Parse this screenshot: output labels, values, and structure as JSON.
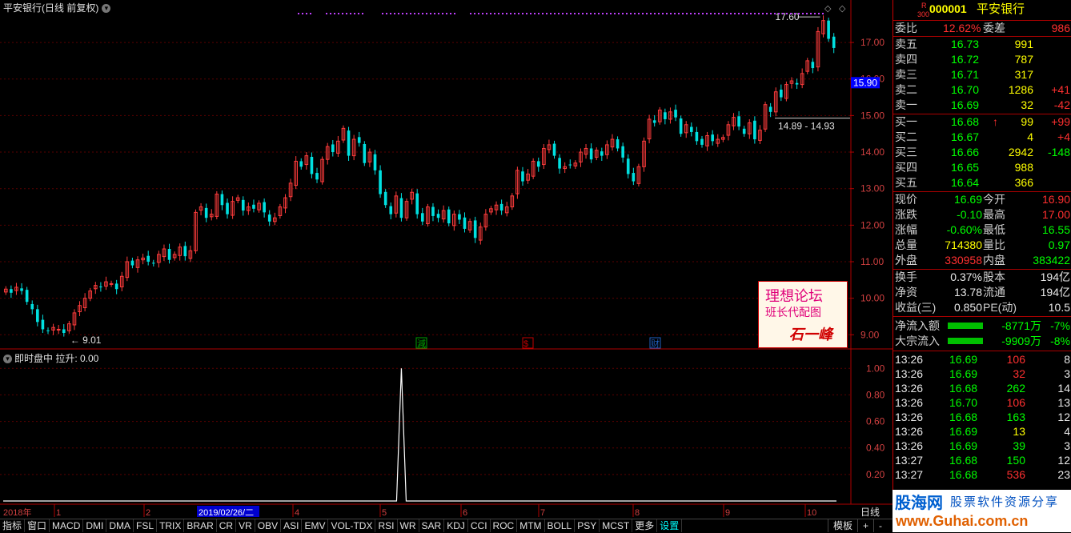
{
  "main_title": "平安银行(日线 前复权)",
  "sub_title": "即时盘中 拉升: 0.00",
  "chart_data": [
    {
      "type": "candlestick",
      "ylim": [
        8.7,
        17.9
      ],
      "y_ticks": [
        "17.00",
        "16.00",
        "15.00",
        "14.00",
        "13.00",
        "12.00",
        "11.00",
        "10.00",
        "9.00"
      ],
      "current_price_label": "15.90",
      "annotations": [
        "17.60",
        "14.89 - 14.93",
        "9.01"
      ],
      "event_markers": [
        "減",
        "$",
        "财"
      ],
      "x_labels": [
        "2018年",
        "1",
        "2",
        "2019/02/26/二",
        "4",
        "5",
        "6",
        "7",
        "8",
        "9",
        "10"
      ],
      "period_label": "日线",
      "closes": [
        10.25,
        10.15,
        10.3,
        10.2,
        9.9,
        9.7,
        9.35,
        9.15,
        9.1,
        9.2,
        9.15,
        9.05,
        9.3,
        9.6,
        9.8,
        10.0,
        10.2,
        10.35,
        10.3,
        10.45,
        10.4,
        10.25,
        10.6,
        11.0,
        10.9,
        11.05,
        11.1,
        11.0,
        10.95,
        11.2,
        11.35,
        11.05,
        11.2,
        11.4,
        11.15,
        11.3,
        12.35,
        12.5,
        12.2,
        12.3,
        12.85,
        12.55,
        12.3,
        12.65,
        12.75,
        12.4,
        12.5,
        12.45,
        12.6,
        12.35,
        12.1,
        12.2,
        12.5,
        12.75,
        13.15,
        13.75,
        13.6,
        13.9,
        13.4,
        13.25,
        13.8,
        14.15,
        14.0,
        14.3,
        14.65,
        13.9,
        14.35,
        14.25,
        13.7,
        14.0,
        13.5,
        12.85,
        12.55,
        12.3,
        12.8,
        12.2,
        12.65,
        12.9,
        12.3,
        12.1,
        12.5,
        12.25,
        12.2,
        12.4,
        12.05,
        12.3,
        12.15,
        11.9,
        12.1,
        11.65,
        11.95,
        12.3,
        12.45,
        12.55,
        12.4,
        12.5,
        12.8,
        13.5,
        13.2,
        13.4,
        13.75,
        13.6,
        14.1,
        14.2,
        13.9,
        13.55,
        13.6,
        13.65,
        13.7,
        14.0,
        14.1,
        13.8,
        14.05,
        13.9,
        14.2,
        14.35,
        14.1,
        13.85,
        13.4,
        13.2,
        13.6,
        14.3,
        14.9,
        14.8,
        15.15,
        14.9,
        15.1,
        14.95,
        14.5,
        14.75,
        14.55,
        14.3,
        14.2,
        14.45,
        14.3,
        14.35,
        14.4,
        14.75,
        14.95,
        14.7,
        14.5,
        14.8,
        14.35,
        14.6,
        15.3,
        15.1,
        15.65,
        15.5,
        15.85,
        15.95,
        15.85,
        16.15,
        16.5,
        16.3,
        17.3,
        17.6,
        17.1,
        16.85
      ],
      "panel2_series": {
        "name": "即时盘中 拉升",
        "y_ticks": [
          "1.00",
          "0.80",
          "0.60",
          "0.40",
          "0.20"
        ],
        "spike_index": 75,
        "spike_value": 1.0,
        "ylim": [
          0,
          1.05
        ]
      }
    }
  ],
  "quote": {
    "code_prefix": "R",
    "code_sub": "300",
    "code": "000001",
    "name": "平安银行",
    "weibi_label": "委比",
    "weibi_value": "12.62%",
    "weicha_label": "委差",
    "weicha_value": "986",
    "asks": [
      {
        "label": "卖五",
        "price": "16.73",
        "vol": "991",
        "chg": ""
      },
      {
        "label": "卖四",
        "price": "16.72",
        "vol": "787",
        "chg": ""
      },
      {
        "label": "卖三",
        "price": "16.71",
        "vol": "317",
        "chg": ""
      },
      {
        "label": "卖二",
        "price": "16.70",
        "vol": "1286",
        "chg": "+41"
      },
      {
        "label": "卖一",
        "price": "16.69",
        "vol": "32",
        "chg": "-42"
      }
    ],
    "bids": [
      {
        "label": "买一",
        "price": "16.68",
        "vol": "99",
        "chg": "+99",
        "arrow": "↑"
      },
      {
        "label": "买二",
        "price": "16.67",
        "vol": "4",
        "chg": "+4",
        "arrow": ""
      },
      {
        "label": "买三",
        "price": "16.66",
        "vol": "2942",
        "chg": "-148",
        "arrow": ""
      },
      {
        "label": "买四",
        "price": "16.65",
        "vol": "988",
        "chg": "",
        "arrow": ""
      },
      {
        "label": "买五",
        "price": "16.64",
        "vol": "366",
        "chg": "",
        "arrow": ""
      }
    ],
    "stats": [
      {
        "l1": "现价",
        "v1": "16.69",
        "c1": "g",
        "l2": "今开",
        "v2": "16.90",
        "c2": "r"
      },
      {
        "l1": "涨跌",
        "v1": "-0.10",
        "c1": "g",
        "l2": "最高",
        "v2": "17.00",
        "c2": "r"
      },
      {
        "l1": "涨幅",
        "v1": "-0.60%",
        "c1": "g",
        "l2": "最低",
        "v2": "16.55",
        "c2": "g"
      },
      {
        "l1": "总量",
        "v1": "714380",
        "c1": "y",
        "l2": "量比",
        "v2": "0.97",
        "c2": "g"
      },
      {
        "l1": "外盘",
        "v1": "330958",
        "c1": "r",
        "l2": "内盘",
        "v2": "383422",
        "c2": "g"
      }
    ],
    "stats2": [
      {
        "l1": "换手",
        "v1": "0.37%",
        "l2": "股本",
        "v2": "194亿"
      },
      {
        "l1": "净资",
        "v1": "13.78",
        "l2": "流通",
        "v2": "194亿"
      },
      {
        "l1": "收益(三)",
        "v1": "0.850",
        "l2": "PE(动)",
        "v2": "10.5"
      }
    ],
    "flow": [
      {
        "label": "净流入额",
        "value": "-8771万",
        "pct": "-7%"
      },
      {
        "label": "大宗流入",
        "value": "-9909万",
        "pct": "-8%"
      }
    ],
    "ticks": [
      {
        "t": "13:26",
        "p": "16.69",
        "v": "106",
        "vc": "r",
        "n": "8"
      },
      {
        "t": "13:26",
        "p": "16.69",
        "v": "32",
        "vc": "r",
        "n": "3"
      },
      {
        "t": "13:26",
        "p": "16.68",
        "v": "262",
        "vc": "g",
        "n": "14"
      },
      {
        "t": "13:26",
        "p": "16.70",
        "v": "106",
        "vc": "r",
        "n": "13"
      },
      {
        "t": "13:26",
        "p": "16.68",
        "v": "163",
        "vc": "g",
        "n": "12"
      },
      {
        "t": "13:26",
        "p": "16.69",
        "v": "13",
        "vc": "y",
        "n": "4"
      },
      {
        "t": "13:26",
        "p": "16.69",
        "v": "39",
        "vc": "g",
        "n": "3"
      },
      {
        "t": "13:27",
        "p": "16.68",
        "v": "150",
        "vc": "g",
        "n": "12"
      },
      {
        "t": "13:27",
        "p": "16.68",
        "v": "536",
        "vc": "r",
        "n": "23"
      }
    ]
  },
  "toolbar": {
    "items": [
      "指标",
      "窗口",
      "MACD",
      "DMI",
      "DMA",
      "FSL",
      "TRIX",
      "BRAR",
      "CR",
      "VR",
      "OBV",
      "ASI",
      "EMV",
      "VOL-TDX",
      "RSI",
      "WR",
      "SAR",
      "KDJ",
      "CCI",
      "ROC",
      "MTM",
      "BOLL",
      "PSY",
      "MCST",
      "更多",
      "设置"
    ],
    "right_items": [
      "模板",
      "+",
      "-"
    ]
  },
  "watermark": {
    "line1": "理想论坛",
    "line2": "班长代配图",
    "sign": "石一峰"
  },
  "logo": {
    "brand": "股海网",
    "slogan": "股票软件资源分享",
    "url": "www.Guhai.com.cn"
  }
}
